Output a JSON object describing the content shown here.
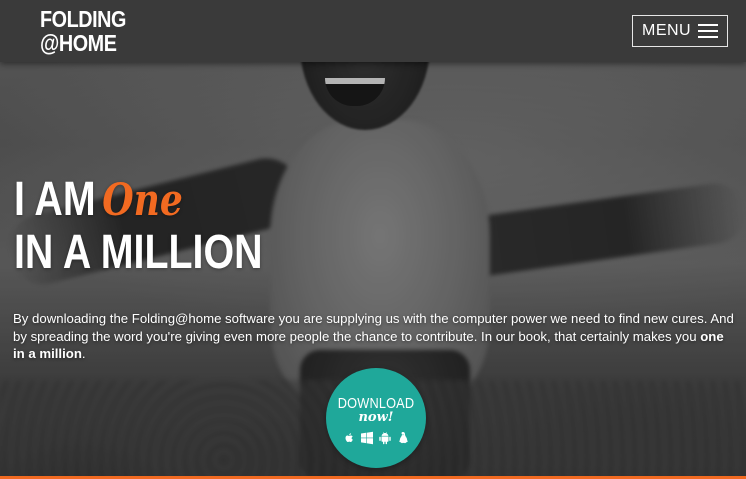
{
  "header": {
    "logo_line1": "FOLDING",
    "logo_line2": "@HOME",
    "menu_label": "MENU"
  },
  "hero": {
    "headline_prefix": "I AM",
    "headline_accent": "One",
    "headline_line2": "IN A MILLION",
    "description_main": "By downloading the Folding@home software you are supplying us with the computer power we need to find new cures. And by spreading the word you're giving even more people the chance to contribute. In our book, that certainly makes you ",
    "description_emphasis": "one in a million",
    "description_end": "."
  },
  "download": {
    "label": "DOWNLOAD",
    "sublabel": "now!",
    "platform_icons": [
      "apple-icon",
      "windows-icon",
      "android-icon",
      "linux-icon"
    ]
  },
  "colors": {
    "accent": "#f26a21",
    "download": "#1fa89a",
    "header": "#3a3a3a"
  }
}
